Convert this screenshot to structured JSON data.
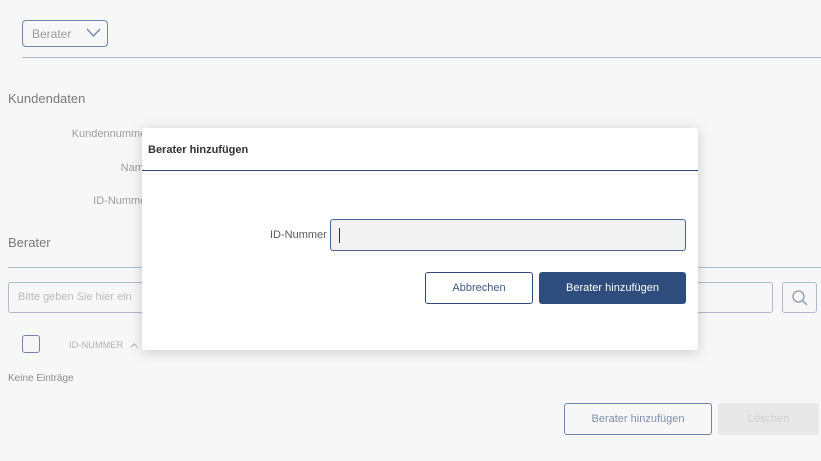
{
  "header": {
    "role_select_value": "Berater"
  },
  "customer": {
    "section_title": "Kundendaten",
    "fields": {
      "customer_number_label": "Kundennummer",
      "name_label": "Name",
      "id_number_label": "ID-Nummer"
    }
  },
  "advisor": {
    "section_title": "Berater",
    "search_placeholder": "Bitte geben Sie hier ein",
    "table": {
      "column_id": "ID-NUMMER",
      "empty_text": "Keine Einträge"
    },
    "add_button": "Berater hinzufügen",
    "delete_button": "Löschen"
  },
  "dialog": {
    "title": "Berater hinzufügen",
    "id_label": "ID-Nummer",
    "id_value": "",
    "cancel_button": "Abbrechen",
    "confirm_button": "Berater hinzufügen"
  },
  "icons": {
    "role_dropdown": "chevron-down-icon",
    "search": "search-icon",
    "sort": "chevron-up-icon"
  },
  "colors": {
    "primary": "#2f4d7c",
    "accent_border": "#2f4c7a",
    "disabled_bg": "#dedede"
  }
}
